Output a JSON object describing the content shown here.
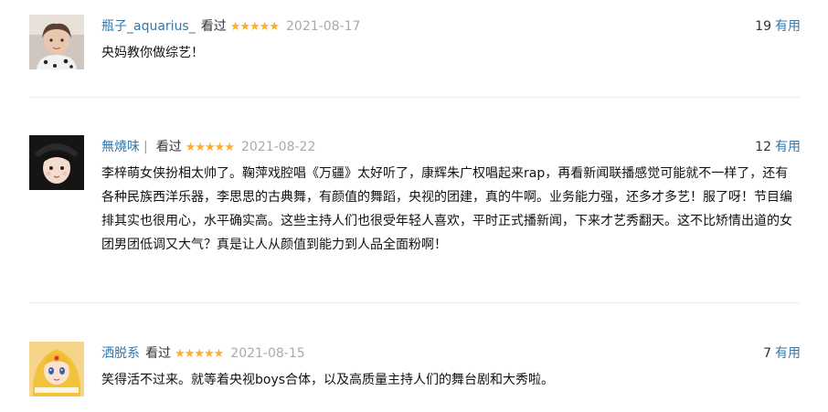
{
  "reviews": [
    {
      "username": "瓶子_aquarius_",
      "separator": "",
      "status": "看过",
      "stars": "★★★★★",
      "rating": 5,
      "date": "2021-08-17",
      "votes": "19",
      "useful_label": "有用",
      "text": "央妈教你做综艺！"
    },
    {
      "username": "無燒味",
      "separator": "|",
      "status": "看过",
      "stars": "★★★★★",
      "rating": 5,
      "date": "2021-08-22",
      "votes": "12",
      "useful_label": "有用",
      "text": "李梓萌女侠扮相太帅了。鞠萍戏腔唱《万疆》太好听了，康辉朱广权唱起来rap，再看新闻联播感觉可能就不一样了，还有各种民族西洋乐器，李思思的古典舞，有颜值的舞蹈，央视的团建，真的牛啊。业务能力强，还多才多艺！服了呀！节目编排其实也很用心，水平确实高。这些主持人们也很受年轻人喜欢，平时正式播新闻，下来才艺秀翻天。这不比矫情出道的女团男团低调又大气？真是让人从颜值到能力到人品全面粉啊！"
    },
    {
      "username": "洒脱系",
      "separator": "",
      "status": "看过",
      "stars": "★★★★★",
      "rating": 5,
      "date": "2021-08-15",
      "votes": "7",
      "useful_label": "有用",
      "text": "笑得活不过来。就等着央视boys合体，以及高质量主持人们的舞台剧和大秀啦。"
    }
  ],
  "colors": {
    "link": "#3377aa",
    "star": "#ffac2d",
    "date": "#aaaaaa",
    "text": "#111111",
    "divider": "#eeeeee"
  }
}
